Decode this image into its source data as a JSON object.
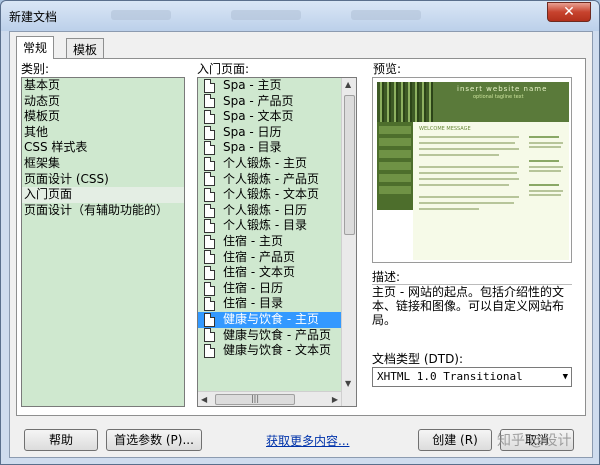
{
  "window": {
    "title": "新建文档",
    "close_glyph": "✕"
  },
  "tabs": [
    {
      "label": "常规",
      "active": true
    },
    {
      "label": "模板",
      "active": false
    }
  ],
  "category": {
    "label": "类别:",
    "items": [
      "基本页",
      "动态页",
      "模板页",
      "其他",
      "CSS 样式表",
      "框架集",
      "页面设计 (CSS)",
      "入门页面",
      "页面设计（有辅助功能的）"
    ],
    "selected": "入门页面"
  },
  "starter_pages": {
    "label": "入门页面:",
    "items": [
      "Spa - 主页",
      "Spa - 产品页",
      "Spa - 文本页",
      "Spa - 日历",
      "Spa - 目录",
      "个人锻炼 - 主页",
      "个人锻炼 - 产品页",
      "个人锻炼 - 文本页",
      "个人锻炼 - 日历",
      "个人锻炼 - 目录",
      "住宿 - 主页",
      "住宿 - 产品页",
      "住宿 - 文本页",
      "住宿 - 日历",
      "住宿 - 目录",
      "健康与饮食 - 主页",
      "健康与饮食 - 产品页",
      "健康与饮食 - 文本页"
    ],
    "selected": "健康与饮食 - 主页"
  },
  "preview": {
    "label": "预览:",
    "site_title": "insert website name",
    "site_tagline": "optional tagline text",
    "welcome": "WELCOME MESSAGE"
  },
  "description": {
    "label": "描述:",
    "text": "主页 - 网站的起点。包括介绍性的文本、链接和图像。可以自定义网站布局。"
  },
  "doctype": {
    "label": "文档类型 (DTD):",
    "value": "XHTML 1.0 Transitional"
  },
  "buttons": {
    "help": "帮助",
    "prefs": "首选参数 (P)...",
    "more": "获取更多内容...",
    "create": "创建 (R)",
    "cancel": "取消"
  },
  "watermark": "知乎 @设计"
}
